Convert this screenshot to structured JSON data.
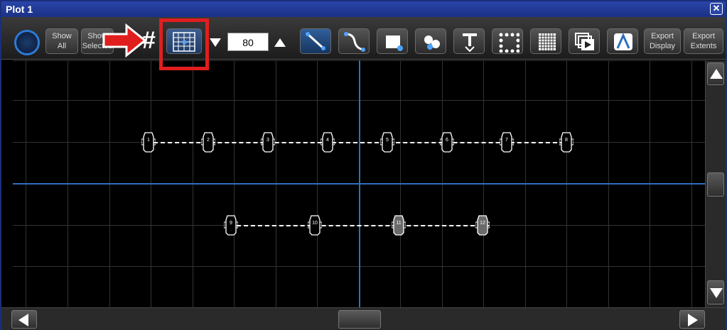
{
  "window": {
    "title": "Plot 1",
    "close_icon": "close-x-icon"
  },
  "toolbar": {
    "show_all_label": "Show\nAll",
    "show_selected_label": "Show\nSelected",
    "grid_size_value": "80",
    "export_display_label": "Export\nDisplay",
    "export_extents_label": "Export\nExtents"
  },
  "plot": {
    "fixtures_row1": [
      "1",
      "2",
      "3",
      "4",
      "5",
      "6",
      "7",
      "8"
    ],
    "fixtures_row2": [
      "9",
      "10",
      "11",
      "12"
    ],
    "selected_fixtures": [
      "11",
      "12"
    ]
  },
  "annotation": {
    "highlight_color": "#e01e1e",
    "target": "grid-snap-button"
  },
  "colors": {
    "title_bar": "#1b3186",
    "axis": "#2d6fc0",
    "background": "#000000"
  }
}
